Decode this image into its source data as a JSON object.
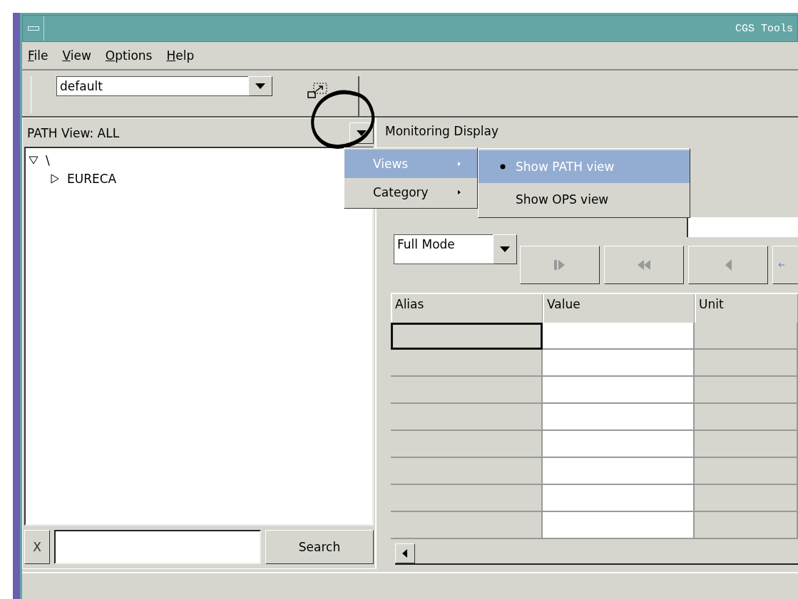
{
  "window": {
    "title": "CGS Tools"
  },
  "menu_bar": [
    {
      "label": "File"
    },
    {
      "label": "View"
    },
    {
      "label": "Options"
    },
    {
      "label": "Help"
    }
  ],
  "toolbar": {
    "profile": "default"
  },
  "path_panel": {
    "header": "PATH View:  ALL",
    "tree": [
      {
        "label": "\\",
        "expanded": true,
        "children": [
          {
            "label": "EURECA",
            "expanded": false
          }
        ]
      }
    ],
    "clear_button": "X",
    "search_button": "Search"
  },
  "monitoring": {
    "title": "Monitoring Display",
    "mode": "Full Mode",
    "columns": [
      "Alias",
      "Value",
      "Unit"
    ]
  },
  "popup_menu": [
    {
      "label": "Views",
      "selected": true
    },
    {
      "label": "Category",
      "selected": false
    }
  ],
  "submenu": [
    {
      "label": "Show PATH view",
      "selected": true
    },
    {
      "label": "Show OPS view",
      "selected": false
    }
  ]
}
